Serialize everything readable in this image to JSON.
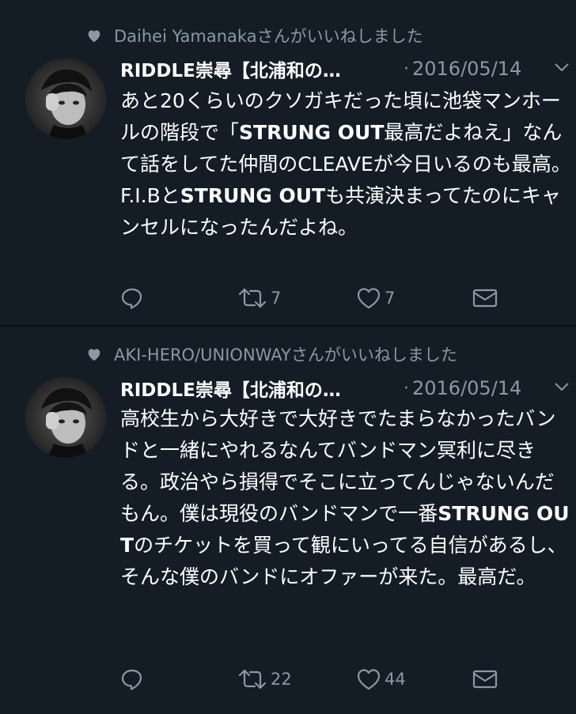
{
  "tweets": [
    {
      "liked_by": "Daihei Yamanakaさんがいいねしました",
      "author_name": "RIDDLE崇尋【北浦和の…",
      "dot": "·",
      "date": "2016/05/14",
      "text_parts": [
        {
          "t": "あと20くらいのクソガキだった頃に池袋マンホールの階段で「",
          "b": false
        },
        {
          "t": "STRUNG OUT",
          "b": true
        },
        {
          "t": "最高だよねえ」なんて話をしてた仲間のCLEAVEが今日いるのも最高。F.I.Bと",
          "b": false
        },
        {
          "t": "STRUNG OUT",
          "b": true
        },
        {
          "t": "も共演決まってたのにキャンセルになったんだよね。",
          "b": false
        }
      ],
      "retweets": "7",
      "likes": "7"
    },
    {
      "liked_by": "AKI-HERO/UNIONWAYさんがいいねしました",
      "author_name": "RIDDLE崇尋【北浦和の…",
      "dot": "·",
      "date": "2016/05/14",
      "text_parts": [
        {
          "t": "高校生から大好きで大好きでたまらなかったバンドと一緒にやれるなんてバンドマン冥利に尽きる。政治やら損得でそこに立ってんじゃないんだもん。僕は現役のバンドマンで一番",
          "b": false
        },
        {
          "t": "STRUNG OUT",
          "b": true
        },
        {
          "t": "のチケットを買って観にいってる自信があるし、そんな僕のバンドにオファーが来た。最高だ。",
          "b": false
        }
      ],
      "retweets": "22",
      "likes": "44"
    }
  ],
  "icons": {
    "liked": "heart-icon",
    "reply": "reply-icon",
    "retweet": "retweet-icon",
    "like": "like-icon",
    "dm": "mail-icon",
    "caret": "chevron-down-icon"
  },
  "colors": {
    "background": "#141d26",
    "text": "#ffffff",
    "muted": "#8899a6"
  }
}
